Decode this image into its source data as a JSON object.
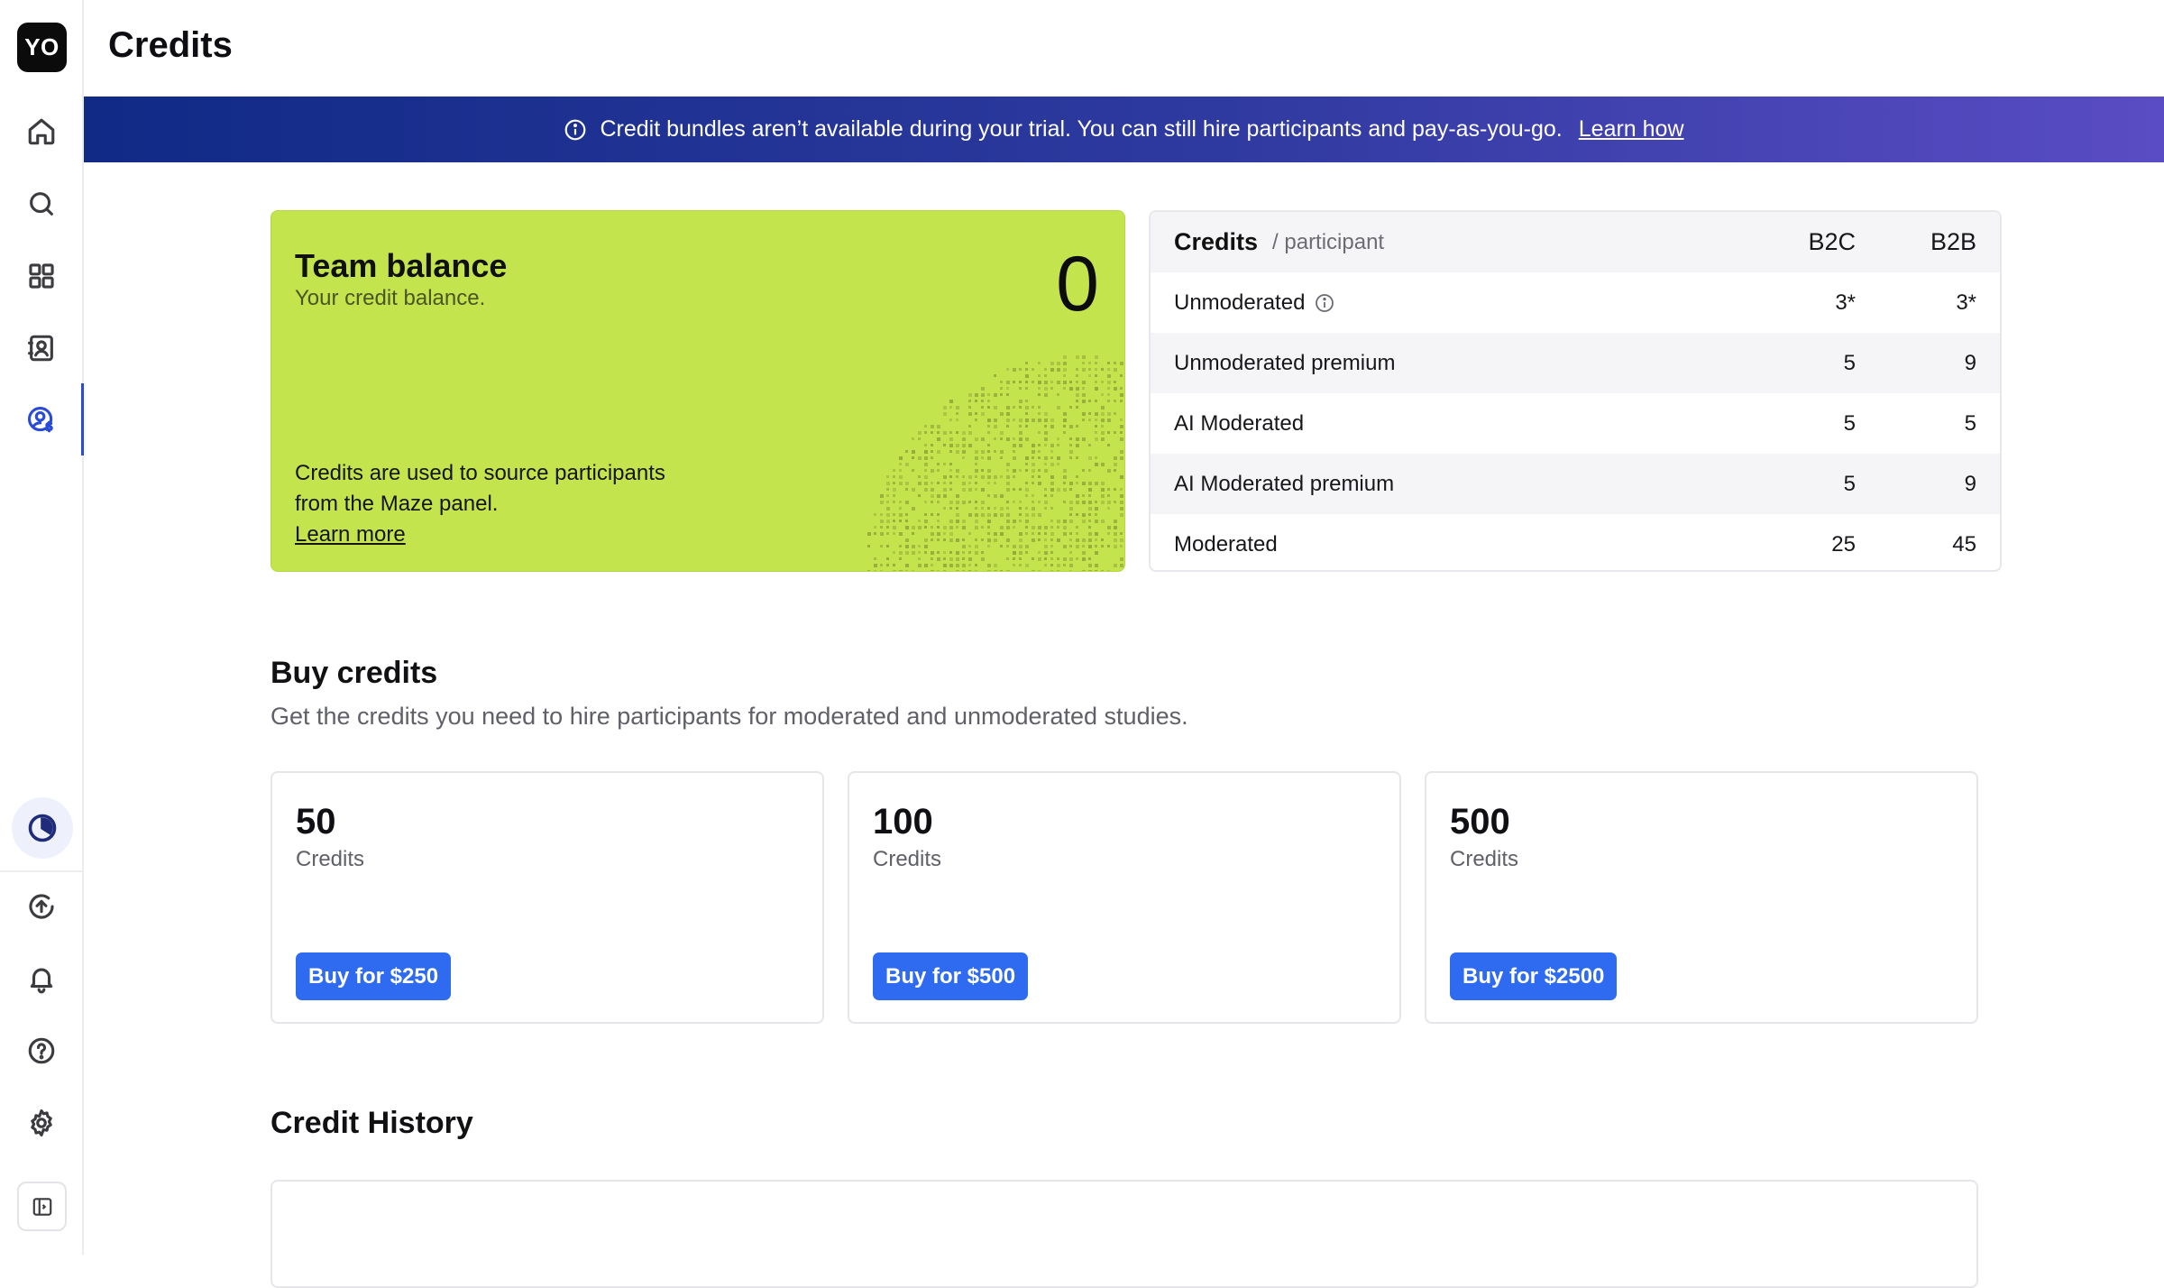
{
  "app": {
    "logo_text": "YO",
    "page_title": "Credits"
  },
  "sidebar": {
    "items": [
      {
        "name": "home",
        "icon": "home-icon"
      },
      {
        "name": "search",
        "icon": "search-icon"
      },
      {
        "name": "projects",
        "icon": "grid-icon"
      },
      {
        "name": "contacts",
        "icon": "contacts-icon"
      },
      {
        "name": "credits",
        "icon": "user-dollar-icon",
        "active": true
      }
    ],
    "bottom": [
      {
        "name": "usage",
        "icon": "pie-clock-icon"
      },
      {
        "name": "upgrade",
        "icon": "upload-circle-icon"
      },
      {
        "name": "notifications",
        "icon": "bell-icon"
      },
      {
        "name": "help",
        "icon": "help-circle-icon"
      },
      {
        "name": "settings",
        "icon": "gear-icon"
      },
      {
        "name": "collapse",
        "icon": "sidebar-toggle-icon"
      }
    ]
  },
  "banner": {
    "text": "Credit bundles aren’t available during your trial. You can still hire participants and pay-as-you-go.",
    "link": "Learn how",
    "colors": {
      "start": "#102a86",
      "end": "#5a4cc4"
    }
  },
  "balance": {
    "title": "Team balance",
    "subtitle": "Your credit balance.",
    "value": "0",
    "description": "Credits are used to source participants from the Maze panel.",
    "link": "Learn more",
    "color": "#c4e44e"
  },
  "credits_table": {
    "title": "Credits",
    "subtitle": "/ participant",
    "columns": [
      "B2C",
      "B2B"
    ],
    "rows": [
      {
        "name": "Unmoderated",
        "b2c": "3*",
        "b2b": "3*",
        "info": true
      },
      {
        "name": "Unmoderated premium",
        "b2c": "5",
        "b2b": "9"
      },
      {
        "name": "AI Moderated",
        "b2c": "5",
        "b2b": "5"
      },
      {
        "name": "AI Moderated premium",
        "b2c": "5",
        "b2b": "9"
      },
      {
        "name": "Moderated",
        "b2c": "25",
        "b2b": "45"
      }
    ]
  },
  "buy": {
    "title": "Buy credits",
    "subtitle": "Get the credits you need to hire participants for moderated and unmoderated studies.",
    "bundles": [
      {
        "amount": "50",
        "label": "Credits",
        "button": "Buy for $250"
      },
      {
        "amount": "100",
        "label": "Credits",
        "button": "Buy for $500"
      },
      {
        "amount": "500",
        "label": "Credits",
        "button": "Buy for $2500"
      }
    ],
    "button_color": "#2f6bf0"
  },
  "history": {
    "title": "Credit History"
  }
}
